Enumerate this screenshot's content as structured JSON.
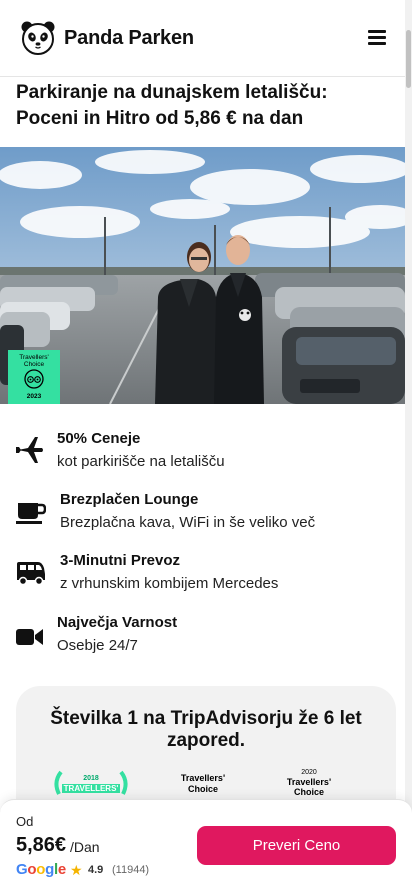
{
  "header": {
    "brand": "Panda Parken",
    "menu_icon": "hamburger-menu-icon"
  },
  "title": {
    "line1": "Parkiranje na dunajskem letališču:",
    "line2": "Poceni in Hitro od 5,86 € na dan"
  },
  "hero": {
    "award": {
      "line1": "Travellers'",
      "line2": "Choice",
      "year": "2023"
    }
  },
  "features": [
    {
      "icon": "airplane-icon",
      "title": "50% Ceneje",
      "subtitle": "kot parkirišče na letališču"
    },
    {
      "icon": "coffee-cup-icon",
      "title": "Brezplačen Lounge",
      "subtitle": "Brezplačna kava, WiFi in še veliko več"
    },
    {
      "icon": "shuttle-van-icon",
      "title": "3-Minutni Prevoz",
      "subtitle": "z vrhunskim kombijem Mercedes"
    },
    {
      "icon": "video-camera-icon",
      "title": "Največja Varnost",
      "subtitle": "Osebje 24/7"
    }
  ],
  "trip": {
    "heading_line1": "Številka 1 na TripAdvisorju že 6 let",
    "heading_line2": "zapored.",
    "badges": [
      {
        "line1": "2018",
        "line2": "TRAVELLERS'"
      },
      {
        "line1": "Travellers'",
        "line2": "Choice"
      },
      {
        "line1": "2020",
        "line2": "Travellers'",
        "line3": "Choice"
      }
    ]
  },
  "bottom_bar": {
    "from_label": "Od",
    "price": "5,86€",
    "per": "/Dan",
    "google": "Google",
    "rating": "4.9",
    "reviews": "(11944)",
    "cta": "Preveri Ceno"
  },
  "colors": {
    "accent": "#e0185f",
    "award_green": "#34e0a1",
    "card_bg": "#f2f2f2"
  }
}
